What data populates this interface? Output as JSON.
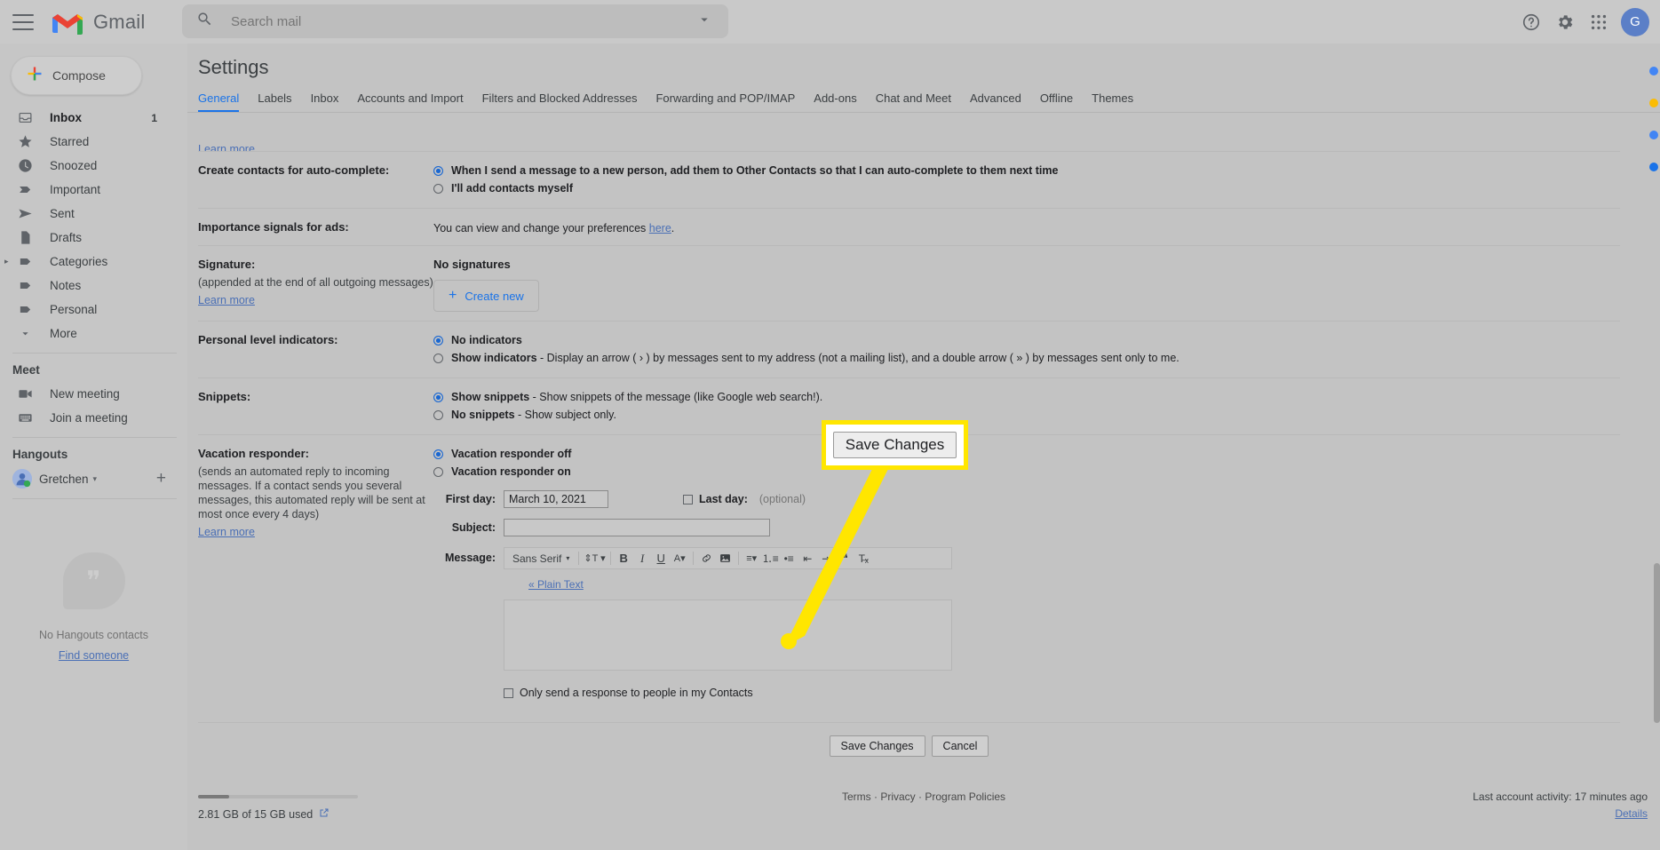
{
  "app": {
    "name": "Gmail",
    "logo_icon": "gmail-logo-icon",
    "menu_icon": "hamburger-menu-icon"
  },
  "search": {
    "placeholder": "Search mail",
    "value": "",
    "icon": "search-icon",
    "options_icon": "chevron-down-icon"
  },
  "topbar": {
    "help_icon": "help-circle-icon",
    "settings_icon": "gear-icon",
    "apps_icon": "apps-grid-icon",
    "avatar_initial": "G"
  },
  "compose": {
    "label": "Compose",
    "icon": "plus-icon"
  },
  "sidebar": {
    "items": [
      {
        "label": "Inbox",
        "icon": "inbox-icon",
        "count": "1",
        "active": true
      },
      {
        "label": "Starred",
        "icon": "star-icon",
        "count": ""
      },
      {
        "label": "Snoozed",
        "icon": "clock-icon",
        "count": ""
      },
      {
        "label": "Important",
        "icon": "important-label-icon",
        "count": ""
      },
      {
        "label": "Sent",
        "icon": "send-icon",
        "count": ""
      },
      {
        "label": "Drafts",
        "icon": "draft-file-icon",
        "count": ""
      },
      {
        "label": "Categories",
        "icon": "label-tag-icon",
        "count": "",
        "expandable": true
      },
      {
        "label": "Notes",
        "icon": "label-tag-icon",
        "count": ""
      },
      {
        "label": "Personal",
        "icon": "label-tag-icon",
        "count": ""
      },
      {
        "label": "More",
        "icon": "chevron-down-icon",
        "count": ""
      }
    ],
    "meet": {
      "title": "Meet",
      "items": [
        {
          "label": "New meeting",
          "icon": "video-camera-icon"
        },
        {
          "label": "Join a meeting",
          "icon": "keyboard-icon"
        }
      ]
    },
    "hangouts": {
      "title": "Hangouts",
      "user": "Gretchen",
      "user_caret_icon": "caret-down-icon",
      "add_icon": "plus-icon",
      "empty_text": "No Hangouts contacts",
      "empty_link": "Find someone",
      "empty_icon": "hangouts-quote-icon"
    }
  },
  "settings": {
    "title": "Settings",
    "tabs": [
      {
        "label": "General",
        "selected": true
      },
      {
        "label": "Labels",
        "selected": false
      },
      {
        "label": "Inbox",
        "selected": false
      },
      {
        "label": "Accounts and Import",
        "selected": false
      },
      {
        "label": "Filters and Blocked Addresses",
        "selected": false
      },
      {
        "label": "Forwarding and POP/IMAP",
        "selected": false
      },
      {
        "label": "Add-ons",
        "selected": false
      },
      {
        "label": "Chat and Meet",
        "selected": false
      },
      {
        "label": "Advanced",
        "selected": false
      },
      {
        "label": "Offline",
        "selected": false
      },
      {
        "label": "Themes",
        "selected": false
      }
    ],
    "cut_off_link": "Learn more",
    "rows": {
      "autocomplete": {
        "label": "Create contacts for auto-complete:",
        "option1": "When I send a message to a new person, add them to Other Contacts so that I can auto-complete to them next time",
        "option2": "I'll add contacts myself",
        "selected": 1
      },
      "importance": {
        "label": "Importance signals for ads:",
        "text_before": "You can view and change your preferences ",
        "link": "here",
        "text_after": "."
      },
      "signature": {
        "label": "Signature:",
        "sub": "(appended at the end of all outgoing messages)",
        "learn_more": "Learn more",
        "no_signatures": "No signatures",
        "create_new": "Create new"
      },
      "personal_level": {
        "label": "Personal level indicators:",
        "option1": "No indicators",
        "option2_bold": "Show indicators",
        "option2_rest": " - Display an arrow ( › ) by messages sent to my address (not a mailing list), and a double arrow ( » ) by messages sent only to me.",
        "selected": 1
      },
      "snippets": {
        "label": "Snippets:",
        "option1_bold": "Show snippets",
        "option1_rest": " - Show snippets of the message (like Google web search!).",
        "option2_bold": "No snippets",
        "option2_rest": " - Show subject only.",
        "selected": 1
      },
      "vacation": {
        "label": "Vacation responder:",
        "sub": "(sends an automated reply to incoming messages. If a contact sends you several messages, this automated reply will be sent at most once every 4 days)",
        "learn_more": "Learn more",
        "option_off": "Vacation responder off",
        "option_on": "Vacation responder on",
        "selected": "off",
        "first_day_label": "First day:",
        "first_day_value": "March 10, 2021",
        "last_day_label": "Last day:",
        "last_day_placeholder": "(optional)",
        "last_day_value": "",
        "last_day_checked": false,
        "subject_label": "Subject:",
        "subject_value": "",
        "message_label": "Message:",
        "plain_text_link": "« Plain Text",
        "only_contacts": "Only send a response to people in my Contacts",
        "only_contacts_checked": false
      }
    },
    "editor_toolbar": {
      "font_family": "Sans Serif",
      "font_caret_icon": "caret-down-icon",
      "buttons": [
        {
          "icon": "font-size-icon",
          "label": "↑T"
        },
        {
          "icon": "bold-icon",
          "label": "B"
        },
        {
          "icon": "italic-icon",
          "label": "I"
        },
        {
          "icon": "underline-icon",
          "label": "U"
        },
        {
          "icon": "text-color-icon",
          "label": "A"
        },
        {
          "icon": "link-icon",
          "label": "🔗"
        },
        {
          "icon": "insert-image-icon",
          "label": "▣"
        },
        {
          "icon": "align-icon",
          "label": "≡"
        },
        {
          "icon": "numbered-list-icon",
          "label": "≣"
        },
        {
          "icon": "bulleted-list-icon",
          "label": "•≡"
        },
        {
          "icon": "indent-less-icon",
          "label": "⇤"
        },
        {
          "icon": "indent-more-icon",
          "label": "⇥"
        },
        {
          "icon": "quote-icon",
          "label": "❝"
        },
        {
          "icon": "remove-formatting-icon",
          "label": "T×"
        }
      ]
    },
    "actions": {
      "save": "Save Changes",
      "cancel": "Cancel"
    }
  },
  "annotation": {
    "callout_label": "Save Changes",
    "highlight_color": "#ffe600",
    "arrow_color": "#ffe600"
  },
  "footer": {
    "storage": "2.81 GB of 15 GB used",
    "storage_icon": "open-in-new-icon",
    "links": [
      "Terms",
      "Privacy",
      "Program Policies"
    ],
    "separator": "·",
    "last_activity": "Last account activity: 17 minutes ago",
    "details": "Details"
  },
  "colors": {
    "accent_blue": "#1a73e8",
    "link_blue": "#4a6fb5",
    "highlight_yellow": "#ffe600",
    "page_bg": "#c3c3c3"
  }
}
